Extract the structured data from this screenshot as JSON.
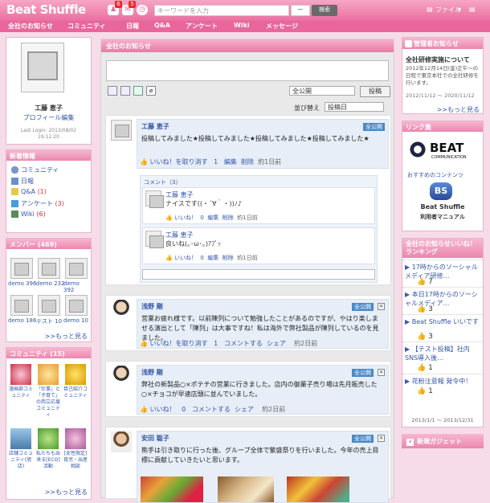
{
  "header": {
    "logo": "Beat Shuffle",
    "badge1": "6",
    "badge2": "5",
    "search_placeholder": "キーワードを入力",
    "search_select": "—",
    "search_button": "検索",
    "file_label": "ファイル",
    "user_label": "工藤"
  },
  "nav": [
    "全社のお知らせ",
    "コミュニティ",
    "日報",
    "Q&A",
    "アンケート",
    "Wiki",
    "メッセージ"
  ],
  "profile": {
    "name": "工藤 恵子",
    "edit_link": "プロフィール編集",
    "last_login_label": "Last Login: 2013/08/02",
    "last_login_time": "19:12:20"
  },
  "news": {
    "title": "新着情報",
    "items": [
      {
        "label": "コミュニティ",
        "count": ""
      },
      {
        "label": "日報",
        "count": ""
      },
      {
        "label": "Q&A",
        "count": "(1)"
      },
      {
        "label": "アンケート",
        "count": "(3)"
      },
      {
        "label": "Wiki",
        "count": "(6)"
      }
    ]
  },
  "members": {
    "title": "メンバー (469)",
    "row1": [
      "demo 396",
      "demo 232",
      "demo 392"
    ],
    "row2": [
      "demo 186",
      "テスト 10",
      "demo 10"
    ],
    "more": ">>もっと見る"
  },
  "community": {
    "title": "コミュニティ (15)",
    "row1": [
      "漫画部コミュニティ",
      "「仕事」と「子育て」の両立応援コミュニティ",
      "目己紹介コミュニティ"
    ],
    "row2": [
      "店舗コミュニティ(旭店)",
      "私たちも出来る[ECO]活動",
      "[女性限定]育児・出産相談"
    ],
    "more": ">>もっと見る"
  },
  "center": {
    "title": "全社のお知らせ",
    "scope_select": "全公開",
    "post_button": "投稿",
    "sort_label": "並び替え",
    "sort_value": "投稿日"
  },
  "posts": [
    {
      "name": "工藤 恵子",
      "badge": "全公開",
      "text": "投稿してみました★投稿してみました★投稿してみました★投稿してみました★",
      "like": "いいね！を取り消す",
      "count": "1",
      "edit": "編集",
      "delete": "削除",
      "time": "約1日前"
    },
    {
      "name": "浅野 剛",
      "badge": "全公開",
      "text": "営業お疲れ様です。以前陳列について勉強したことがあるのですが、やはり楽しませる演出として「陳列」は大事ですね！私は海外で弊社製品が陳列しているのを見ました。",
      "like": "いいね！を取り消す",
      "count": "1",
      "comment": "コメントする",
      "share": "シェア",
      "time": "約2日前"
    },
    {
      "name": "浅野 剛",
      "badge": "全公開",
      "text": "弊社の新製品○×ポテチの営業に行きました。店内の御菓子売り場は先月販売した○×チョコが早速店頭に並んでいました。",
      "like": "いいね！",
      "count": "0",
      "comment": "コメントする",
      "share": "シェア",
      "time": "約2日前"
    },
    {
      "name": "安田 聡子",
      "badge": "全公開",
      "text": "熊手は引き取りに行った後、グループ全体で繁盛祭りを行いました。今年の売上目標に貢献していきたいと思います。"
    }
  ],
  "comments": {
    "label": "コメント（3）",
    "items": [
      {
        "name": "工藤 恵子",
        "text": "ナイスです((・´∀｀・))ﾉ♪",
        "like": "いいね！",
        "count": "0",
        "edit": "編集",
        "delete": "削除",
        "time": "約1日前"
      },
      {
        "name": "工藤 恵子",
        "text": "良いね(｡･ω･｡)ｱﾌﾟｯ",
        "like": "いいね！",
        "count": "0",
        "edit": "編集",
        "delete": "削除",
        "time": "約1日前"
      }
    ]
  },
  "admin": {
    "title": "管理者お知らせ",
    "heading": "全社研修実施について",
    "text": "2012年12月14日(金)正午～の日程で東京本社での全社研修を行います。",
    "period": "2012/11/12 ～ 2020/11/12",
    "more": ">>もっと見る"
  },
  "links": {
    "title": "リンク集",
    "beat": "BEAT",
    "beat_sub": "COMMUNICATION",
    "recommend": "おすすめのコンテンツ",
    "bs_title": "Beat Shuffle",
    "bs_sub": "利用者マニュアル"
  },
  "ranking": {
    "title": "全社のお知らせいいね！ランキング",
    "items": [
      {
        "text": "17時からのソーシャルメディア研修…",
        "count": "7"
      },
      {
        "text": "本日17時からのソーシャルメディア…",
        "count": "3"
      },
      {
        "text": "Beat Shuffle いいです",
        "count": "3"
      },
      {
        "text": "【テスト投稿】社内SNS導入後…",
        "count": "1"
      },
      {
        "text": "花粉注意報 発令中！",
        "count": "1"
      }
    ],
    "period": "2013/1/1 ～ 2013/12/31"
  },
  "gadget": {
    "label": "新規ガジェット"
  }
}
